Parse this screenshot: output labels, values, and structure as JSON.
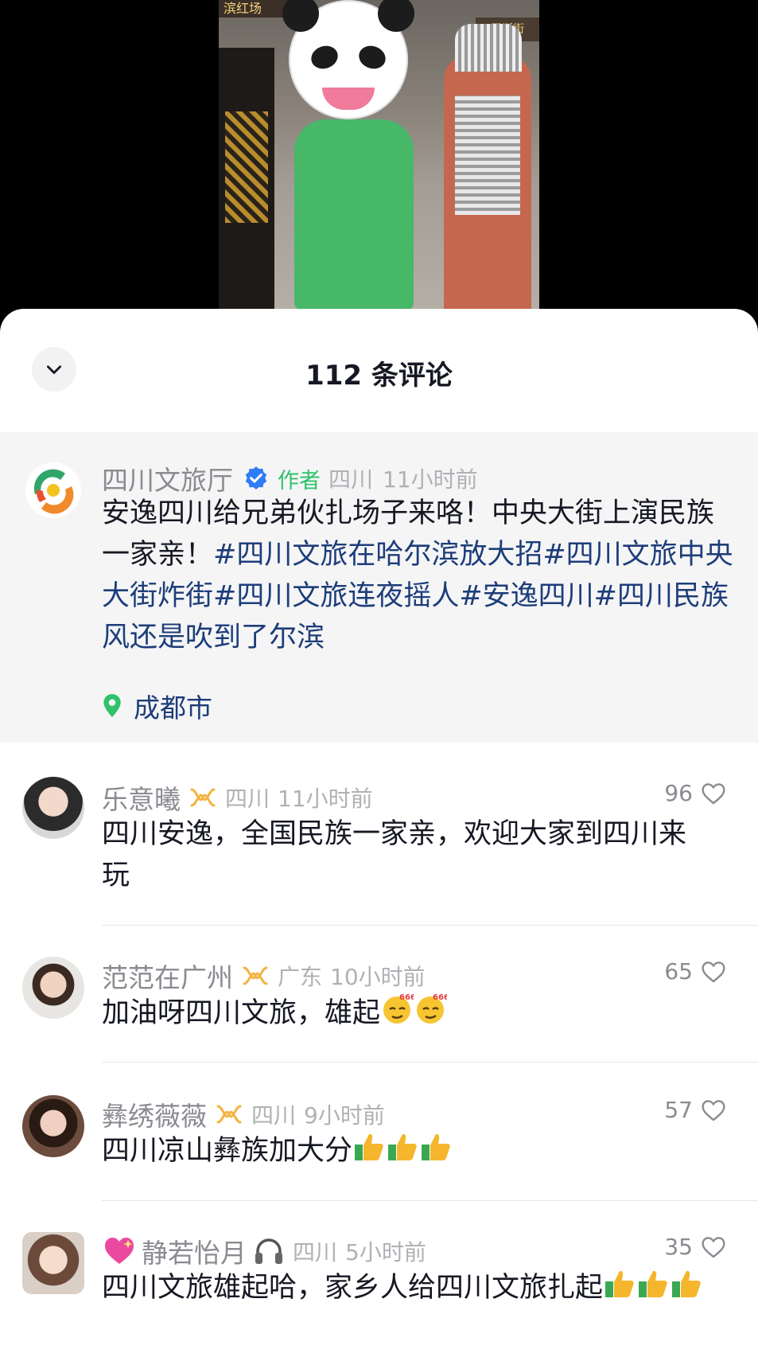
{
  "video": {
    "sign_left": "滨红场",
    "sign_right": "罗斯街"
  },
  "header": {
    "title": "112 条评论"
  },
  "pinned": {
    "author_name": "四川文旅厅",
    "author_tag": "作者",
    "region": "四川",
    "time": "11小时前",
    "text_plain_1": "安逸四川给兄弟伙扎场子来咯！中央大街上演民族一家亲！",
    "hashtag_1": "#四川文旅在哈尔滨放大招",
    "hashtag_2": "#四川文旅中央大街炸街",
    "hashtag_3": "#四川文旅连夜摇人",
    "hashtag_4": "#安逸四川",
    "hashtag_5": "#四川民族风还是吹到了尔滨",
    "location": "成都市"
  },
  "comments": [
    {
      "name": "乐意曦",
      "region": "四川",
      "time": "11小时前",
      "likes": "96",
      "text": "四川安逸，全国民族一家亲，欢迎大家到四川来玩"
    },
    {
      "name": "范范在广州",
      "region": "广东",
      "time": "10小时前",
      "likes": "65",
      "text": "加油呀四川文旅，雄起"
    },
    {
      "name": "彝绣薇薇",
      "region": "四川",
      "time": "9小时前",
      "likes": "57",
      "text": "四川凉山彝族加大分"
    },
    {
      "name": "静若怡月",
      "region": "四川",
      "time": "5小时前",
      "likes": "35",
      "text": "四川文旅雄起哈，家乡人给四川文旅扎起"
    }
  ],
  "icons": {
    "verified_color": "#2f7cf6",
    "accent_green": "#2ec26b",
    "hashtag_color": "#1d3d7a"
  }
}
